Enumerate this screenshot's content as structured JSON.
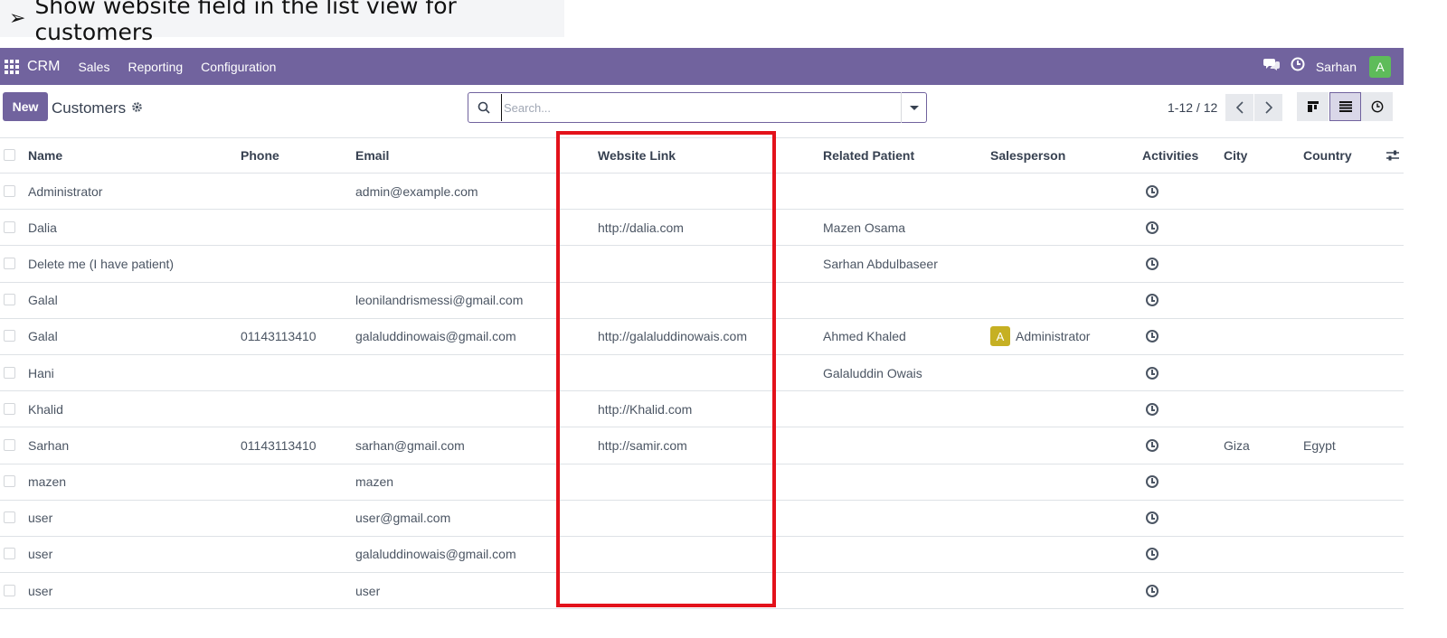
{
  "caption": {
    "arrow": "➢",
    "text": "Show website field in the list view for customers"
  },
  "navbar": {
    "app_name": "CRM",
    "menu": [
      "Sales",
      "Reporting",
      "Configuration"
    ],
    "user_name": "Sarhan",
    "user_initial": "A",
    "icons": [
      "apps-icon",
      "chat-icon",
      "activity-clock-icon"
    ]
  },
  "control": {
    "new_label": "New",
    "breadcrumb": "Customers",
    "search_placeholder": "Search...",
    "pager": "1-12 / 12"
  },
  "table": {
    "columns": {
      "name": "Name",
      "phone": "Phone",
      "email": "Email",
      "website": "Website Link",
      "patient": "Related Patient",
      "salesperson": "Salesperson",
      "activities": "Activities",
      "city": "City",
      "country": "Country"
    },
    "rows": [
      {
        "name": "Administrator",
        "phone": "",
        "email": "admin@example.com",
        "website": "",
        "patient": "",
        "salesperson": "",
        "sp_initial": "",
        "city": "",
        "country": ""
      },
      {
        "name": "Dalia",
        "phone": "",
        "email": "",
        "website": "http://dalia.com",
        "patient": "Mazen Osama",
        "salesperson": "",
        "sp_initial": "",
        "city": "",
        "country": ""
      },
      {
        "name": "Delete me (I have patient)",
        "phone": "",
        "email": "",
        "website": "",
        "patient": "Sarhan Abdulbaseer",
        "salesperson": "",
        "sp_initial": "",
        "city": "",
        "country": ""
      },
      {
        "name": "Galal",
        "phone": "",
        "email": "leonilandrismessi@gmail.com",
        "website": "",
        "patient": "",
        "salesperson": "",
        "sp_initial": "",
        "city": "",
        "country": ""
      },
      {
        "name": "Galal",
        "phone": "01143113410",
        "email": "galaluddinowais@gmail.com",
        "website": "http://galaluddinowais.com",
        "patient": "Ahmed Khaled",
        "salesperson": "Administrator",
        "sp_initial": "A",
        "city": "",
        "country": ""
      },
      {
        "name": "Hani",
        "phone": "",
        "email": "",
        "website": "",
        "patient": "Galaluddin Owais",
        "salesperson": "",
        "sp_initial": "",
        "city": "",
        "country": ""
      },
      {
        "name": "Khalid",
        "phone": "",
        "email": "",
        "website": "http://Khalid.com",
        "patient": "",
        "salesperson": "",
        "sp_initial": "",
        "city": "",
        "country": ""
      },
      {
        "name": "Sarhan",
        "phone": "01143113410",
        "email": "sarhan@gmail.com",
        "website": "http://samir.com",
        "patient": "",
        "salesperson": "",
        "sp_initial": "",
        "city": "Giza",
        "country": "Egypt"
      },
      {
        "name": "mazen",
        "phone": "",
        "email": "mazen",
        "website": "",
        "patient": "",
        "salesperson": "",
        "sp_initial": "",
        "city": "",
        "country": ""
      },
      {
        "name": "user",
        "phone": "",
        "email": "user@gmail.com",
        "website": "",
        "patient": "",
        "salesperson": "",
        "sp_initial": "",
        "city": "",
        "country": ""
      },
      {
        "name": "user",
        "phone": "",
        "email": "galaluddinowais@gmail.com",
        "website": "",
        "patient": "",
        "salesperson": "",
        "sp_initial": "",
        "city": "",
        "country": ""
      },
      {
        "name": "user",
        "phone": "",
        "email": "user",
        "website": "",
        "patient": "",
        "salesperson": "",
        "sp_initial": "",
        "city": "",
        "country": ""
      }
    ]
  },
  "colors": {
    "brand": "#71639e",
    "highlight": "#e3121b",
    "avatar_user": "#5ebc5a",
    "avatar_salesperson": "#c6b023"
  }
}
